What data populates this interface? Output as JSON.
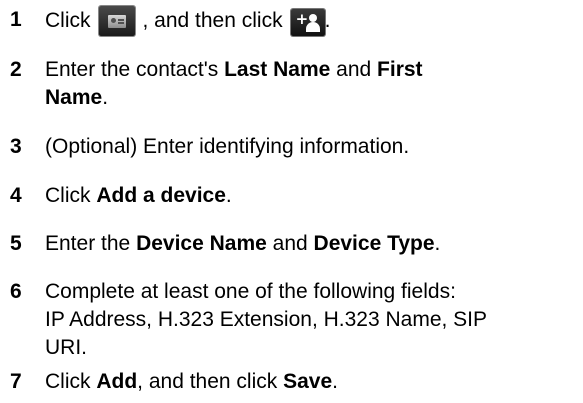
{
  "steps": [
    {
      "number": "1",
      "prefix": "Click",
      "mid": ", and then click",
      "suffix": ".",
      "icons": [
        "contacts-book-icon",
        "add-contact-icon"
      ]
    },
    {
      "number": "2",
      "t1": "Enter the contact's ",
      "b1": "Last Name",
      "t2": " and ",
      "b2": "First",
      "b3": "Name",
      "t3": "."
    },
    {
      "number": "3",
      "text": "(Optional) Enter identifying information."
    },
    {
      "number": "4",
      "t1": "Click ",
      "b1": "Add a device",
      "t2": "."
    },
    {
      "number": "5",
      "t1": "Enter the ",
      "b1": "Device Name",
      "t2": " and ",
      "b2": "Device Type",
      "t3": "."
    },
    {
      "number": "6",
      "line1": "Complete at least one of the following fields:",
      "line2": "IP Address, H.323 Extension, H.323 Name, SIP",
      "line3": "URI."
    },
    {
      "number": "7",
      "t1": "Click ",
      "b1": "Add",
      "t2": ", and then click ",
      "b2": "Save",
      "t3": "."
    }
  ]
}
